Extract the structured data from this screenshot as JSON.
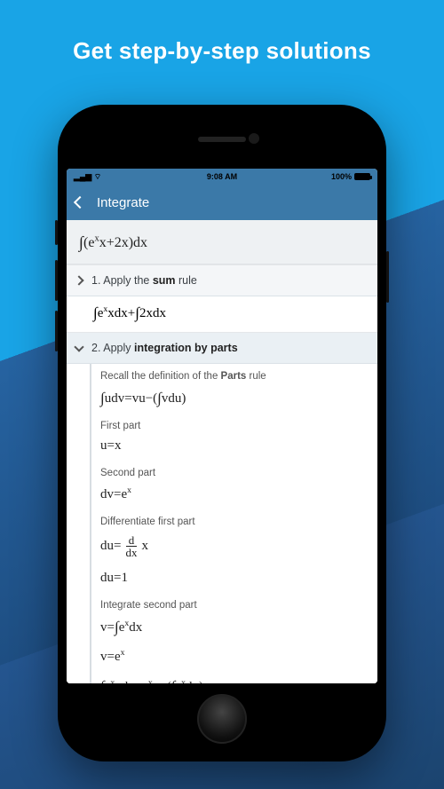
{
  "promo": {
    "headline": "Get step-by-step solutions"
  },
  "status": {
    "left": "􀙇 ",
    "time": "9:08 AM",
    "right": "100%"
  },
  "nav": {
    "title": "Integrate"
  },
  "expression": "∫(eˣx+2x)dx",
  "steps": [
    {
      "num": "1.",
      "title_pre": "Apply the ",
      "title_bold": "sum",
      "title_post": " rule",
      "expanded": false,
      "result": "∫eˣxdx+∫2xdx"
    },
    {
      "num": "2.",
      "title_pre": "Apply ",
      "title_bold": "integration by parts",
      "title_post": "",
      "expanded": true,
      "lines": [
        {
          "label_pre": "Recall the definition of the ",
          "label_bold": "Parts",
          "label_post": " rule"
        },
        {
          "math": "∫udv=vu−(∫vdu)"
        },
        {
          "label": "First part"
        },
        {
          "math": "u=x"
        },
        {
          "label": "Second part"
        },
        {
          "math": "dv=eˣ"
        },
        {
          "label": "Differentiate first part"
        },
        {
          "math_frac": {
            "pre": "du=",
            "num": "d",
            "den": "dx",
            "post": "x"
          }
        },
        {
          "math": "du=1"
        },
        {
          "label": "Integrate second part"
        },
        {
          "math": "v=∫eˣdx"
        },
        {
          "math": "v=eˣ"
        },
        {
          "math": "∫eˣxdx=eˣx−(∫eˣdx)"
        }
      ]
    }
  ]
}
